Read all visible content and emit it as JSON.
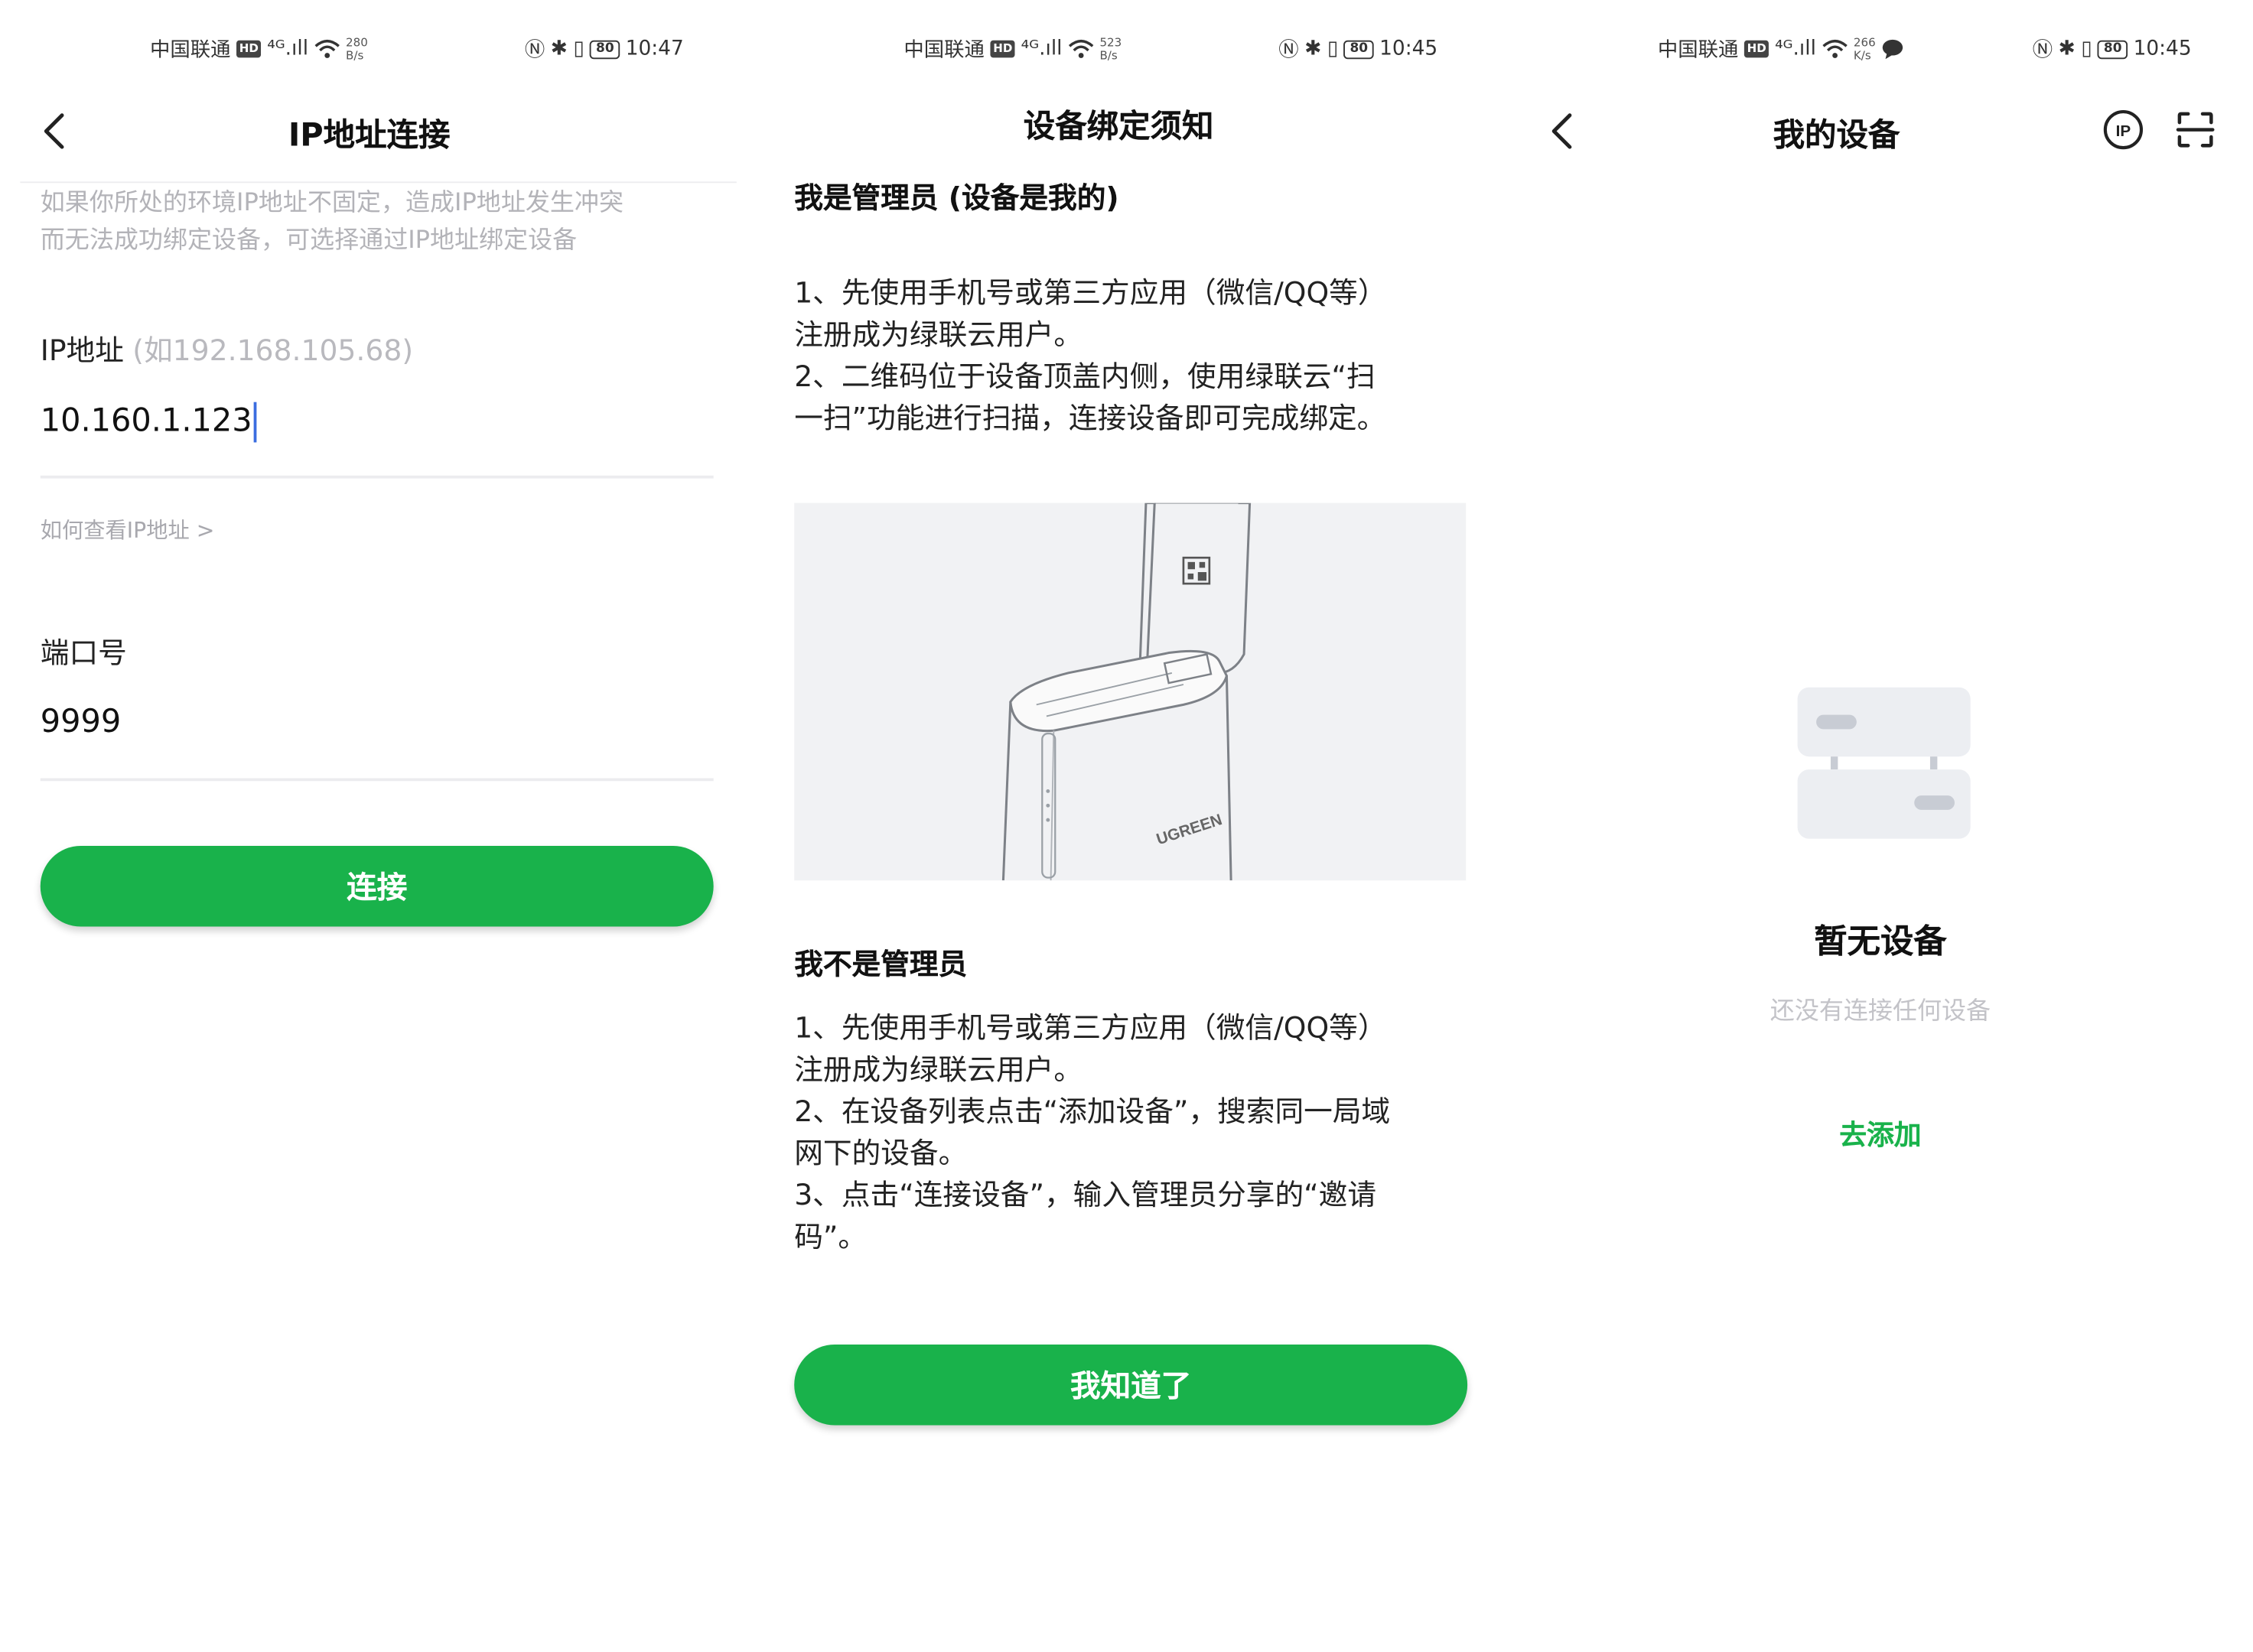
{
  "status_bars": [
    {
      "carrier": "中国联通",
      "hd": "HD",
      "signal": "⁴ᴳ.ıll",
      "speed_num": "280",
      "speed_unit": "B/s",
      "time": "10:47",
      "battery": "80"
    },
    {
      "carrier": "中国联通",
      "hd": "HD",
      "signal": "⁴ᴳ.ıll",
      "speed_num": "523",
      "speed_unit": "B/s",
      "time": "10:45",
      "battery": "80"
    },
    {
      "carrier": "中国联通",
      "hd": "HD",
      "signal": "⁴ᴳ.ıll",
      "speed_num": "266",
      "speed_unit": "K/s",
      "time": "10:45",
      "battery": "80"
    }
  ],
  "ip_screen": {
    "title": "IP地址连接",
    "hint_lines": [
      "如果你所处的环境IP地址不固定，造成IP地址发生冲突",
      "而无法成功绑定设备，可选择通过IP地址绑定设备"
    ],
    "ip_label": "IP地址",
    "ip_example": "(如192.168.105.68)",
    "ip_value": "10.160.1.123",
    "how_to_link": "如何查看IP地址 >",
    "port_label": "端口号",
    "port_value": "9999",
    "connect_button": "连接"
  },
  "notice_screen": {
    "title": "设备绑定须知",
    "admin_title": "我是管理员 (设备是我的)",
    "admin_lines": [
      "1、先使用手机号或第三方应用（微信/QQ等）",
      "注册成为绿联云用户。",
      " 2、二维码位于设备顶盖内侧，使用绿联云“扫",
      "一扫”功能进行扫描，连接设备即可完成绑定。"
    ],
    "device_brand": "UGREEN",
    "non_admin_title": "我不是管理员",
    "non_admin_lines": [
      "1、先使用手机号或第三方应用（微信/QQ等）",
      "注册成为绿联云用户。",
      " 2、在设备列表点击“添加设备”，搜索同一局域",
      "网下的设备。",
      " 3、点击“连接设备”，输入管理员分享的“邀请",
      "码”。"
    ],
    "ok_button": "我知道了"
  },
  "devices_screen": {
    "title": "我的设备",
    "ip_icon_label": "IP",
    "empty_title": "暂无设备",
    "empty_subtitle": "还没有连接任何设备",
    "add_link": "去添加"
  },
  "colors": {
    "accent_green": "#19b24b",
    "hint_gray": "#b3b3b8",
    "divider": "#ececef"
  }
}
